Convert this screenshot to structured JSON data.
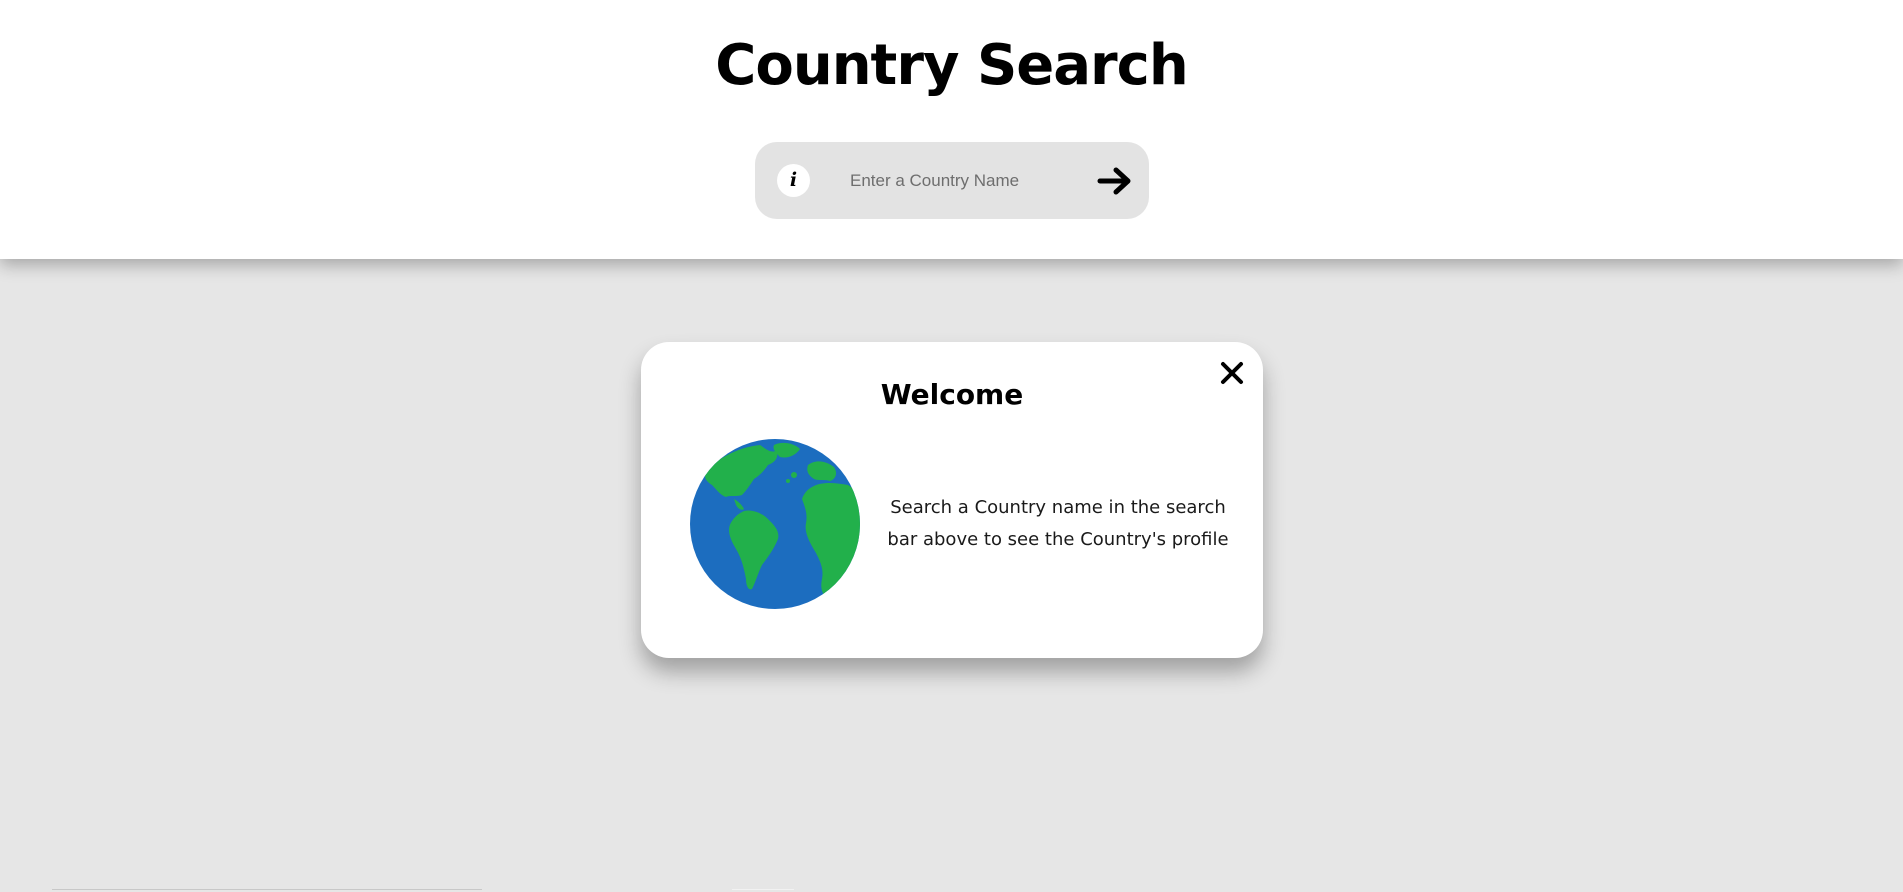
{
  "header": {
    "title": "Country Search"
  },
  "search": {
    "placeholder": "Enter a Country Name",
    "value": "",
    "info_icon": "info-icon",
    "info_glyph": "i",
    "submit_icon": "arrow-right-icon"
  },
  "welcome": {
    "title": "Welcome",
    "message": "Search a Country name in the search bar above to see the Country's profile",
    "close_icon": "close-icon",
    "image": "globe-icon"
  },
  "colors": {
    "page_background": "#e6e6e6",
    "header_background": "#ffffff",
    "search_background": "#e3e3e3",
    "card_background": "#ffffff",
    "globe_ocean": "#1c6dbf",
    "globe_land": "#22b04b"
  }
}
